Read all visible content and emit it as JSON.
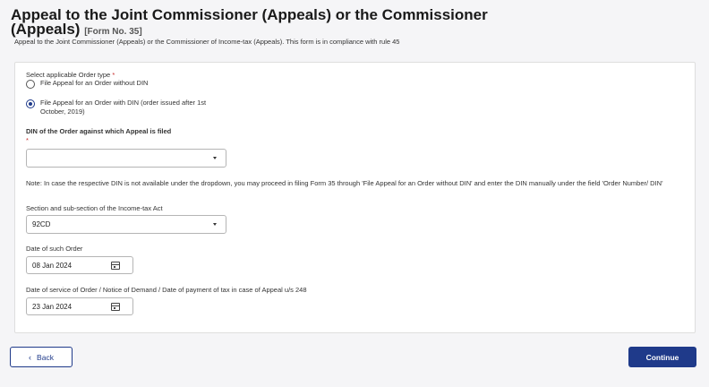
{
  "header": {
    "title": "Appeal to the Joint Commissioner (Appeals) or the Commissioner (Appeals)",
    "form_no": "[Form No. 35]",
    "subtitle": "Appeal to the Joint Commissioner (Appeals) or the Commissioner of Income-tax (Appeals). This form is in compliance with rule 45"
  },
  "form": {
    "order_type_label": "Select applicable Order type",
    "required_mark": "*",
    "options": [
      {
        "label": "File Appeal for an Order without DIN",
        "selected": false
      },
      {
        "label": "File Appeal for an Order with DIN (order issued after 1st October, 2019)",
        "selected": true
      }
    ],
    "din_label": "DIN of the Order against which Appeal is filed",
    "din_value": "",
    "note": "Note:  In case the respective DIN is not available under the dropdown, you may proceed in filing Form 35 through 'File Appeal for an Order without DIN' and enter the DIN manually under the field 'Order Number/ DIN'",
    "section_label": "Section and sub-section of the Income-tax Act",
    "section_value": "92CD",
    "order_date_label": "Date of such Order",
    "order_date_value": "08 Jan 2024",
    "service_date_label": "Date of service of Order / Notice of Demand / Date of payment of tax in case of Appeal u/s 248",
    "service_date_value": "23 Jan 2024"
  },
  "footer": {
    "back_label": "Back",
    "back_icon": "chevron-left-icon",
    "continue_label": "Continue"
  },
  "colors": {
    "primary": "#1f3a8a",
    "required": "#c62828"
  }
}
